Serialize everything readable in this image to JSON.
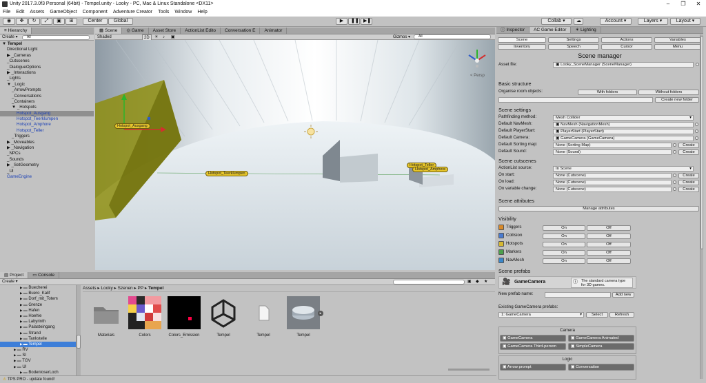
{
  "window": {
    "title": "Unity 2017.3.0f3 Personal (64bit) - Tempel.unity - Looky - PC, Mac & Linux Standalone <DX11>",
    "controls": [
      "–",
      "❐",
      "✕"
    ]
  },
  "menu": [
    "File",
    "Edit",
    "Assets",
    "GameObject",
    "Component",
    "Adventure Creator",
    "Tools",
    "Window",
    "Help"
  ],
  "toolbar": {
    "pivot": "Center",
    "space": "Global",
    "collab": "Collab ▾",
    "account": "Account",
    "layers": "Layers",
    "layout": "Layout"
  },
  "hierarchy": {
    "tab": "Hierarchy",
    "create": "Create",
    "search": "All",
    "rows": [
      {
        "text": "▼ Tempel",
        "indent": 0,
        "bold": true
      },
      {
        "text": "Directional Light",
        "indent": 1
      },
      {
        "text": "▶ _Cameras",
        "indent": 1
      },
      {
        "text": "_Cutscenes",
        "indent": 1
      },
      {
        "text": "_DialogueOptions",
        "indent": 1
      },
      {
        "text": "▶ _Interactions",
        "indent": 1
      },
      {
        "text": "_Lights",
        "indent": 1
      },
      {
        "text": "▼ _Logic",
        "indent": 1
      },
      {
        "text": "_ArrowPrompts",
        "indent": 2
      },
      {
        "text": "_Conversations",
        "indent": 2
      },
      {
        "text": "_Containers",
        "indent": 2
      },
      {
        "text": "▼ _Hotspots",
        "indent": 2
      },
      {
        "text": "Hotspot_Ausgang",
        "indent": 3,
        "blue": true,
        "selected": true
      },
      {
        "text": "Hotspot_Teerklumpen",
        "indent": 3,
        "blue": true
      },
      {
        "text": "Hotspot_Amphore",
        "indent": 3,
        "blue": true
      },
      {
        "text": "Hotspot_Teller",
        "indent": 3,
        "blue": true
      },
      {
        "text": "_Triggers",
        "indent": 2
      },
      {
        "text": "▶ _Moveables",
        "indent": 1
      },
      {
        "text": "▶ _Navigation",
        "indent": 1
      },
      {
        "text": "_NPCs",
        "indent": 1
      },
      {
        "text": "_Sounds",
        "indent": 1
      },
      {
        "text": "▶ _SetGeometry",
        "indent": 1
      },
      {
        "text": "_UI",
        "indent": 1
      },
      {
        "text": "GameEngine",
        "indent": 1,
        "blue": true
      }
    ]
  },
  "scene_tabs": [
    "Scene",
    "Game",
    "Asset Store",
    "ActionList Edito",
    "Conversation E",
    "Animator"
  ],
  "scene_bar": {
    "shading": "Shaded",
    "mode": "2D",
    "gizmos": "Gizmos ▾",
    "search": "All"
  },
  "scene": {
    "hotspot_labels": [
      "Hotspot_Ausgang",
      "Hotspot_Teerklumpen",
      "Hotspot_Teller",
      "Hotspot_Amphore"
    ],
    "persp": "< Persp"
  },
  "project": {
    "tabs": [
      "Project",
      "Console"
    ],
    "create": "Create",
    "breadcrumb": [
      "Assets",
      "Looky",
      "Szenen",
      "PP",
      "Tempel"
    ],
    "folders": [
      {
        "text": "Buecherei",
        "indent": 3
      },
      {
        "text": "Buero_Kalif",
        "indent": 3
      },
      {
        "text": "Dorf_mit_Totem",
        "indent": 3
      },
      {
        "text": "Grenze",
        "indent": 3
      },
      {
        "text": "Hafen",
        "indent": 3
      },
      {
        "text": "Hoehle",
        "indent": 3
      },
      {
        "text": "Labyrinth",
        "indent": 3
      },
      {
        "text": "Palasteingang",
        "indent": 3
      },
      {
        "text": "Strand",
        "indent": 3
      },
      {
        "text": "Tankstelle",
        "indent": 3
      },
      {
        "text": "Tempel",
        "indent": 3,
        "selected": true
      },
      {
        "text": "RV",
        "indent": 2
      },
      {
        "text": "SI",
        "indent": 2
      },
      {
        "text": "TGV",
        "indent": 2
      },
      {
        "text": "UI",
        "indent": 2
      },
      {
        "text": "BodenloserLoch",
        "indent": 3
      }
    ],
    "assets": [
      "Materials",
      "Colors",
      "Colors_Emission",
      "Tempel",
      "Tempel",
      "Tempel"
    ]
  },
  "status": "TPS PRO - update found!",
  "inspector": {
    "tabs": [
      "Inspector",
      "AC Game Editor",
      "Lighting"
    ],
    "nav_row1": [
      "Scene",
      "Settings",
      "Actions",
      "Variables"
    ],
    "nav_row2": [
      "Inventory",
      "Speech",
      "Cursor",
      "Menu"
    ],
    "title": "Scene manager",
    "asset_file_label": "Asset file:",
    "asset_file_value": "Looky_SceneManager (SceneManager)",
    "basic_structure": "Basic structure",
    "organise_label": "Organise room objects:",
    "with_folders": "With folders",
    "without_folders": "Without folders",
    "create_folder": "Create new folder",
    "scene_settings": "Scene settings",
    "settings_rows": [
      {
        "label": "Pathfinding method:",
        "value": "Mesh Collider",
        "kind": "dropdown"
      },
      {
        "label": "Default NavMesh:",
        "value": "NavMesh (NavigationMesh)",
        "kind": "object"
      },
      {
        "label": "Default PlayerStart:",
        "value": "PlayerStart (PlayerStart)",
        "kind": "object"
      },
      {
        "label": "Default Camera:",
        "value": "GameCamera (GameCamera)",
        "kind": "object"
      },
      {
        "label": "Default Sorting map:",
        "value": "None (Sorting Map)",
        "kind": "create"
      },
      {
        "label": "Default Sound:",
        "value": "None (Sound)",
        "kind": "create"
      }
    ],
    "create_label": "Create",
    "scene_cutscenes": "Scene cutscenes",
    "cutscene_rows": [
      {
        "label": "ActionList source:",
        "value": "In Scene",
        "kind": "dropdown"
      },
      {
        "label": "On start:",
        "value": "None (Cutscene)",
        "kind": "create"
      },
      {
        "label": "On load:",
        "value": "None (Cutscene)",
        "kind": "create"
      },
      {
        "label": "On variable change:",
        "value": "None (Cutscene)",
        "kind": "create"
      }
    ],
    "scene_attributes": "Scene attributes",
    "manage_attributes": "Manage attributes",
    "visibility": "Visibility",
    "visibility_rows": [
      "Triggers",
      "Collision",
      "Hotspots",
      "Markers",
      "NavMesh"
    ],
    "on_label": "On",
    "off_label": "Off",
    "scene_prefabs": "Scene prefabs",
    "prefab_name": "GameCamera",
    "prefab_help": "The standard camera type for 3D games.",
    "new_prefab_label": "New prefab name:",
    "add_new": "Add new",
    "existing_label": "Existing GameCamera prefabs:",
    "existing_value": "1: GameCamera",
    "select": "Select",
    "refresh": "Refresh",
    "camera_header": "Camera",
    "camera_buttons": [
      "GameCamera",
      "GameCamera Animated",
      "GameCamera Third-person",
      "SimpleCamera"
    ],
    "logic_header": "Logic",
    "logic_buttons": [
      "Arrow prompt",
      "Conversation"
    ]
  }
}
